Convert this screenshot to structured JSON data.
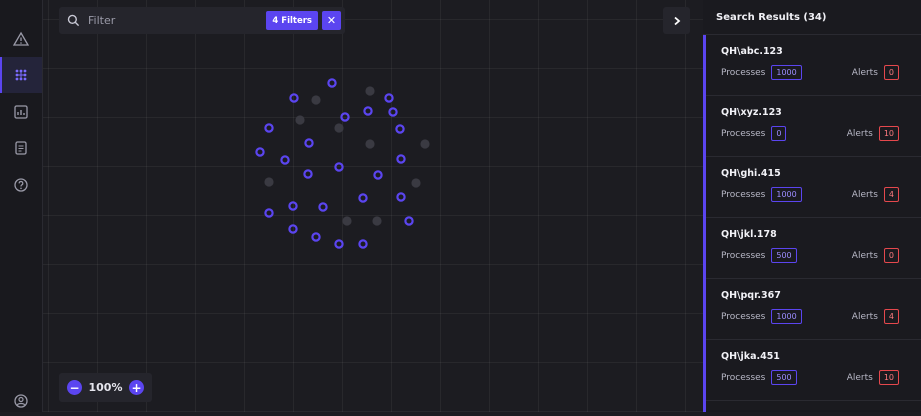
{
  "filter": {
    "placeholder": "Filter",
    "active_filters_label": "4 Filters",
    "clear_symbol": "✕"
  },
  "zoom": {
    "level": "100%",
    "minus": "−",
    "plus": "+"
  },
  "results": {
    "title": "Search Results (34)",
    "processes_label": "Processes",
    "alerts_label": "Alerts",
    "items": [
      {
        "name": "QH\\abc.123",
        "processes": "1000",
        "alerts": "0"
      },
      {
        "name": "QH\\xyz.123",
        "processes": "0",
        "alerts": "10"
      },
      {
        "name": "QH\\ghi.415",
        "processes": "1000",
        "alerts": "4"
      },
      {
        "name": "QH\\jkl.178",
        "processes": "500",
        "alerts": "0"
      },
      {
        "name": "QH\\pqr.367",
        "processes": "1000",
        "alerts": "4"
      },
      {
        "name": "QH\\jka.451",
        "processes": "500",
        "alerts": "10"
      }
    ]
  },
  "rail": {
    "items": [
      "alert-icon",
      "network-icon",
      "chart-icon",
      "document-icon",
      "help-icon"
    ],
    "bottom": "user-icon"
  },
  "colors": {
    "accent": "#5b45f0",
    "alert": "#e5484d",
    "inactive_node": "#3a3a42"
  }
}
